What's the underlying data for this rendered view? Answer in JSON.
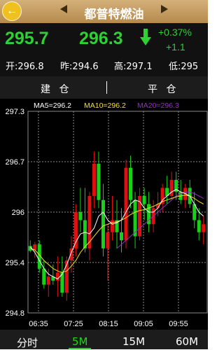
{
  "header": {
    "title": "都普特燃油",
    "back_icon": "back-arrow-icon"
  },
  "quote": {
    "price": "295.7",
    "last": "296.3",
    "change_pct": "+0.37%",
    "change": "+1.1",
    "open": "开:296.8",
    "prev_close": "昨:294.6",
    "high": "高:297.1",
    "low": "低:295",
    "price_color": "#2ed034"
  },
  "actions": {
    "open_position": "建 仓",
    "close_position": "平 仓"
  },
  "chart_data": {
    "type": "candlestick",
    "ylim": [
      294.8,
      297.3
    ],
    "y_ticks": [
      "297.3",
      "296.7",
      "296",
      "295.4",
      "294.8"
    ],
    "x_ticks": [
      "06:35",
      "07:25",
      "08:15",
      "09:05",
      "09:55"
    ],
    "legend": [
      {
        "label": "MA5=296.2",
        "color": "#ffffff"
      },
      {
        "label": "MA10=296.2",
        "color": "#f0e020"
      },
      {
        "label": "MA20=296.3",
        "color": "#9030c0"
      }
    ],
    "up_color": "#e01010",
    "down_color": "#18d018",
    "candles": [
      {
        "o": 295.63,
        "h": 295.7,
        "l": 295.55,
        "c": 295.57
      },
      {
        "o": 295.58,
        "h": 295.68,
        "l": 295.48,
        "c": 295.65
      },
      {
        "o": 295.65,
        "h": 295.7,
        "l": 295.3,
        "c": 295.35
      },
      {
        "o": 295.35,
        "h": 295.45,
        "l": 295.1,
        "c": 295.15
      },
      {
        "o": 295.15,
        "h": 295.35,
        "l": 295.0,
        "c": 295.25
      },
      {
        "o": 295.25,
        "h": 295.4,
        "l": 295.15,
        "c": 295.2
      },
      {
        "o": 295.2,
        "h": 295.5,
        "l": 295.0,
        "c": 295.3
      },
      {
        "o": 295.3,
        "h": 295.5,
        "l": 295.0,
        "c": 295.05
      },
      {
        "o": 295.05,
        "h": 295.5,
        "l": 294.95,
        "c": 295.45
      },
      {
        "o": 295.45,
        "h": 295.75,
        "l": 295.3,
        "c": 295.6
      },
      {
        "o": 295.6,
        "h": 296.15,
        "l": 295.5,
        "c": 296.05
      },
      {
        "o": 296.05,
        "h": 296.35,
        "l": 295.8,
        "c": 295.95
      },
      {
        "o": 295.95,
        "h": 296.35,
        "l": 295.55,
        "c": 295.6
      },
      {
        "o": 295.6,
        "h": 296.3,
        "l": 295.45,
        "c": 296.25
      },
      {
        "o": 296.25,
        "h": 296.8,
        "l": 296.1,
        "c": 296.65
      },
      {
        "o": 296.65,
        "h": 296.8,
        "l": 296.1,
        "c": 296.2
      },
      {
        "o": 296.2,
        "h": 296.4,
        "l": 295.5,
        "c": 295.6
      },
      {
        "o": 295.6,
        "h": 295.9,
        "l": 295.2,
        "c": 295.8
      },
      {
        "o": 295.8,
        "h": 296.25,
        "l": 295.7,
        "c": 295.95
      },
      {
        "o": 295.95,
        "h": 296.2,
        "l": 295.6,
        "c": 295.8
      },
      {
        "o": 295.8,
        "h": 296.1,
        "l": 295.55,
        "c": 295.7
      },
      {
        "o": 295.7,
        "h": 296.7,
        "l": 295.6,
        "c": 296.6
      },
      {
        "o": 296.6,
        "h": 296.75,
        "l": 296.1,
        "c": 296.2
      },
      {
        "o": 296.2,
        "h": 296.3,
        "l": 295.6,
        "c": 295.75
      },
      {
        "o": 295.75,
        "h": 296.35,
        "l": 295.7,
        "c": 296.25
      },
      {
        "o": 296.25,
        "h": 296.35,
        "l": 295.95,
        "c": 296.15
      },
      {
        "o": 296.15,
        "h": 296.3,
        "l": 295.8,
        "c": 295.9
      },
      {
        "o": 295.9,
        "h": 296.2,
        "l": 295.8,
        "c": 296.1
      },
      {
        "o": 296.1,
        "h": 296.3,
        "l": 296.0,
        "c": 296.15
      },
      {
        "o": 296.15,
        "h": 296.4,
        "l": 296.05,
        "c": 296.35
      },
      {
        "o": 296.35,
        "h": 296.5,
        "l": 296.15,
        "c": 296.25
      },
      {
        "o": 296.25,
        "h": 296.55,
        "l": 296.2,
        "c": 296.45
      },
      {
        "o": 296.45,
        "h": 296.55,
        "l": 296.2,
        "c": 296.3
      },
      {
        "o": 296.3,
        "h": 296.45,
        "l": 296.15,
        "c": 296.2
      },
      {
        "o": 296.2,
        "h": 296.4,
        "l": 296.1,
        "c": 296.35
      },
      {
        "o": 296.35,
        "h": 296.45,
        "l": 296.1,
        "c": 296.15
      },
      {
        "o": 296.15,
        "h": 296.3,
        "l": 295.85,
        "c": 295.95
      },
      {
        "o": 295.95,
        "h": 296.1,
        "l": 295.7,
        "c": 295.8
      },
      {
        "o": 295.8,
        "h": 296.0,
        "l": 295.65,
        "c": 295.9
      }
    ],
    "ma5": [
      295.62,
      295.55,
      295.45,
      295.35,
      295.28,
      295.25,
      295.22,
      295.28,
      295.4,
      295.55,
      295.68,
      295.78,
      295.8,
      295.78,
      295.85,
      296.0,
      296.05,
      295.95,
      295.9,
      295.92,
      295.95,
      296.05,
      296.15,
      296.2,
      296.18,
      296.1,
      296.05,
      296.05,
      296.1,
      296.2,
      296.25,
      296.3,
      296.33,
      296.3,
      296.28,
      296.25,
      296.15,
      296.05,
      296.0
    ],
    "ma10": [
      295.6,
      295.58,
      295.52,
      295.45,
      295.4,
      295.35,
      295.32,
      295.3,
      295.32,
      295.38,
      295.45,
      295.55,
      295.62,
      295.68,
      295.75,
      295.82,
      295.88,
      295.9,
      295.92,
      295.93,
      295.95,
      295.98,
      296.02,
      296.05,
      296.07,
      296.08,
      296.1,
      296.12,
      296.15,
      296.18,
      296.2,
      296.22,
      296.24,
      296.25,
      296.26,
      296.25,
      296.22,
      296.18,
      296.15
    ],
    "ma20": [
      null,
      null,
      null,
      null,
      null,
      null,
      null,
      null,
      null,
      null,
      null,
      null,
      null,
      null,
      null,
      null,
      null,
      null,
      null,
      295.6,
      295.65,
      295.7,
      295.75,
      295.8,
      295.85,
      295.9,
      295.95,
      296.0,
      296.05,
      296.1,
      296.15,
      296.2,
      296.25,
      296.28,
      296.3,
      296.3,
      296.28,
      296.25,
      296.22
    ]
  },
  "tabs": {
    "items": [
      "分时",
      "5M",
      "15M",
      "60M"
    ],
    "active": "5M",
    "active_color": "#21d321"
  }
}
